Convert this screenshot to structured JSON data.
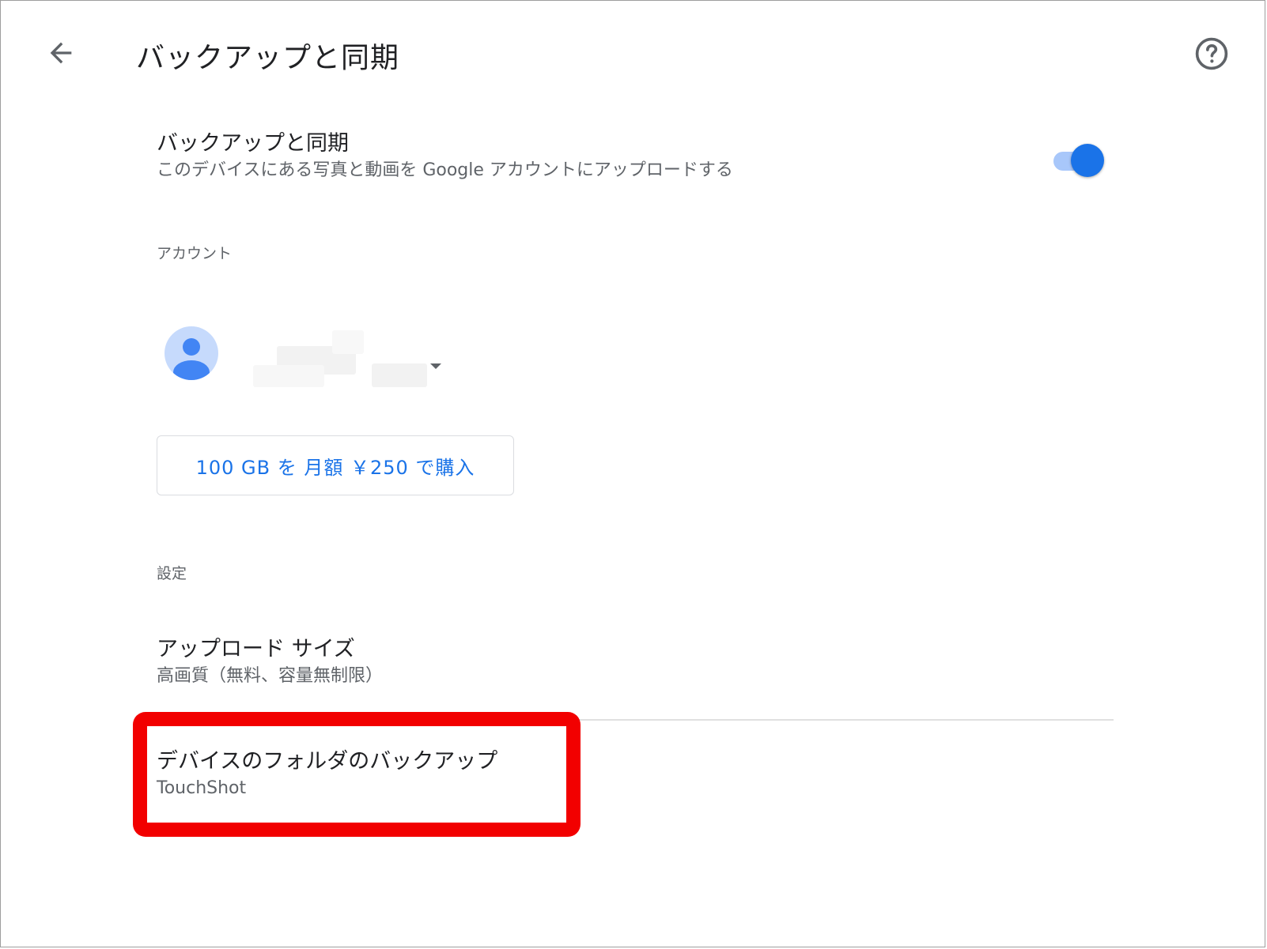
{
  "header": {
    "title": "バックアップと同期"
  },
  "sync": {
    "title": "バックアップと同期",
    "subtitle": "このデバイスにある写真と動画を Google アカウントにアップロードする",
    "enabled": true,
    "accent_color": "#1a73e8"
  },
  "account": {
    "section_label": "アカウント",
    "avatar_icon": "person-avatar-icon",
    "buy_label": "100 GB を 月額 ￥250 で購入"
  },
  "settings": {
    "section_label": "設定",
    "upload_size": {
      "title": "アップロード サイズ",
      "value": "高画質（無料、容量無制限）"
    },
    "device_folders": {
      "title": "デバイスのフォルダのバックアップ",
      "value": "TouchShot"
    }
  },
  "annotation": {
    "highlight_color": "#f20000"
  }
}
